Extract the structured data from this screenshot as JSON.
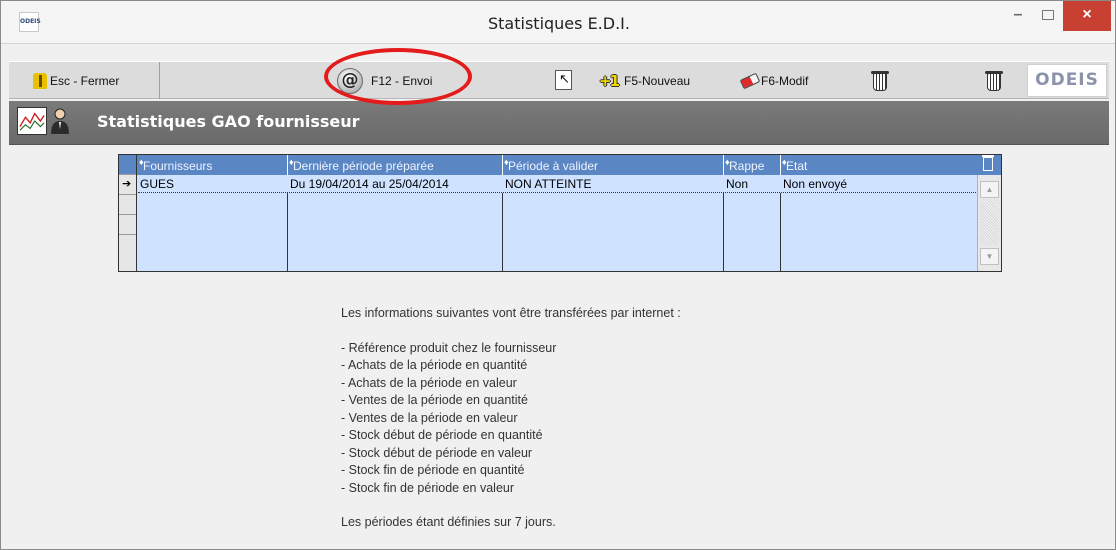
{
  "window": {
    "app_icon_text": "ODEIS",
    "title": "Statistiques E.D.I.",
    "minimize": "–",
    "close": "×"
  },
  "toolbar": {
    "close_label": "Esc - Fermer",
    "send_label": "F12 - Envoi",
    "new_label": "F5-Nouveau",
    "modify_label": "F6-Modif",
    "logo_text": "ODEIS"
  },
  "header": {
    "title": "Statistiques GAO fournisseur"
  },
  "grid": {
    "columns": [
      "Fournisseurs",
      "Dernière période préparée",
      "Période à valider",
      "Rappe",
      "Etat"
    ],
    "rows": [
      [
        "GUES",
        "Du 19/04/2014 au 25/04/2014",
        "NON ATTEINTE",
        "Non",
        "Non envoyé"
      ]
    ]
  },
  "info": {
    "intro": "Les informations suivantes vont être transférées par internet :",
    "items": [
      "- Référence produit chez le fournisseur",
      "- Achats de la période en quantité",
      "- Achats de la période en valeur",
      "- Ventes de la période en quantité",
      "- Ventes de la période en valeur",
      "- Stock début de période en quantité",
      "- Stock début de période en valeur",
      "- Stock fin de période en quantité",
      "- Stock fin de période en valeur"
    ],
    "footer": "Les périodes étant définies sur 7 jours."
  }
}
